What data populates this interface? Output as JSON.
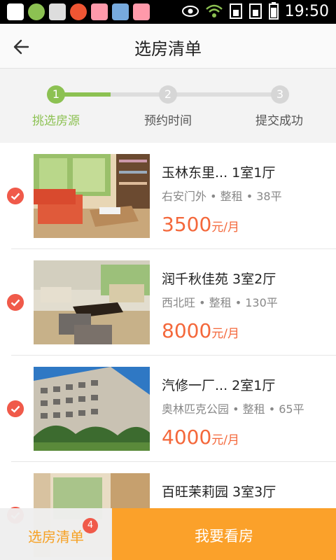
{
  "status_bar": {
    "time": "19:50"
  },
  "header": {
    "title": "选房清单"
  },
  "steps": [
    {
      "number": "1",
      "label": "挑选房源",
      "state": "active"
    },
    {
      "number": "2",
      "label": "预约时间",
      "state": "pending"
    },
    {
      "number": "3",
      "label": "提交成功",
      "state": "pending"
    }
  ],
  "listings": [
    {
      "name": "玉林东里...  1室1厅",
      "meta": "右安门外 • 整租 • 38平",
      "price": "3500",
      "unit": "元/月",
      "selected": true
    },
    {
      "name": "润千秋佳苑  3室2厅",
      "meta": "西北旺 • 整租 • 130平",
      "price": "8000",
      "unit": "元/月",
      "selected": true
    },
    {
      "name": "汽修一厂...  2室1厅",
      "meta": "奥林匹克公园 • 整租 • 65平",
      "price": "4000",
      "unit": "元/月",
      "selected": true
    },
    {
      "name": "百旺茉莉园  3室3厅",
      "meta": "",
      "price": "",
      "unit": "",
      "selected": true
    }
  ],
  "bottom_bar": {
    "list_label": "选房清单",
    "badge_count": "4",
    "action_label": "我要看房"
  },
  "colors": {
    "accent_green": "#8cc152",
    "price_orange": "#f4683b",
    "action_orange": "#fba12a",
    "check_red": "#f05a4a"
  }
}
